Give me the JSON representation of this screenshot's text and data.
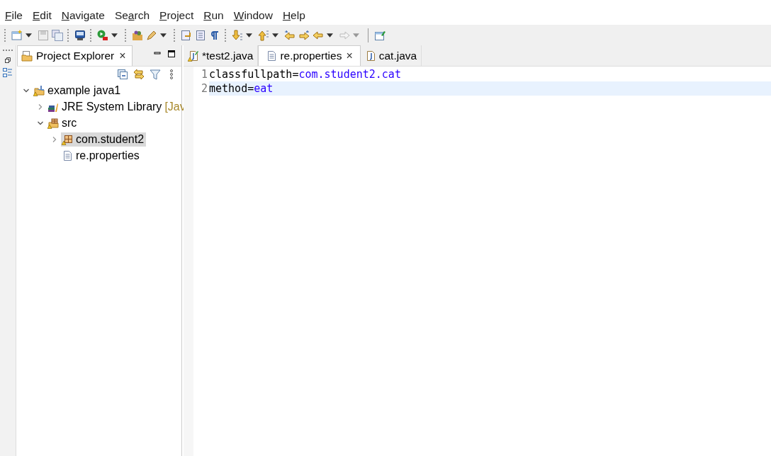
{
  "menu": [
    {
      "mnemonic": "F",
      "after": "ile"
    },
    {
      "mnemonic": "E",
      "after": "dit"
    },
    {
      "mnemonic": "N",
      "after": "avigate"
    },
    {
      "before": "Se",
      "mnemonic": "a",
      "after": "rch"
    },
    {
      "mnemonic": "P",
      "after": "roject"
    },
    {
      "mnemonic": "R",
      "after": "un"
    },
    {
      "mnemonic": "W",
      "after": "indow"
    },
    {
      "mnemonic": "H",
      "after": "elp"
    }
  ],
  "project_explorer": {
    "title": "Project Explorer",
    "close": "×",
    "tree": [
      {
        "label": "example java1",
        "kind": "project",
        "expanded": true,
        "selected": false,
        "children": [
          {
            "label": "JRE System Library",
            "decoration": "[Jav",
            "kind": "library",
            "expanded": false,
            "selected": false
          },
          {
            "label": "src",
            "kind": "source-folder",
            "expanded": true,
            "selected": false,
            "children": [
              {
                "label": "com.student2",
                "kind": "package",
                "expanded": false,
                "selected": true
              },
              {
                "label": "re.properties",
                "kind": "file",
                "selected": false
              }
            ]
          }
        ]
      }
    ]
  },
  "editor": {
    "tabs": [
      {
        "label": "*test2.java",
        "kind": "java-edited",
        "selected": false
      },
      {
        "label": "re.properties",
        "kind": "text",
        "selected": true,
        "close": "×"
      },
      {
        "label": "cat.java",
        "kind": "java",
        "selected": false
      }
    ],
    "lines": [
      {
        "number": "1",
        "current": false,
        "tokens": [
          {
            "text": "classfullpath",
            "kind": "key"
          },
          {
            "text": "=",
            "kind": "operator"
          },
          {
            "text": "com.student2.cat",
            "kind": "value"
          }
        ]
      },
      {
        "number": "2",
        "current": true,
        "tokens": [
          {
            "text": "method",
            "kind": "key"
          },
          {
            "text": "=",
            "kind": "operator"
          },
          {
            "text": "eat",
            "kind": "value"
          }
        ]
      }
    ]
  }
}
